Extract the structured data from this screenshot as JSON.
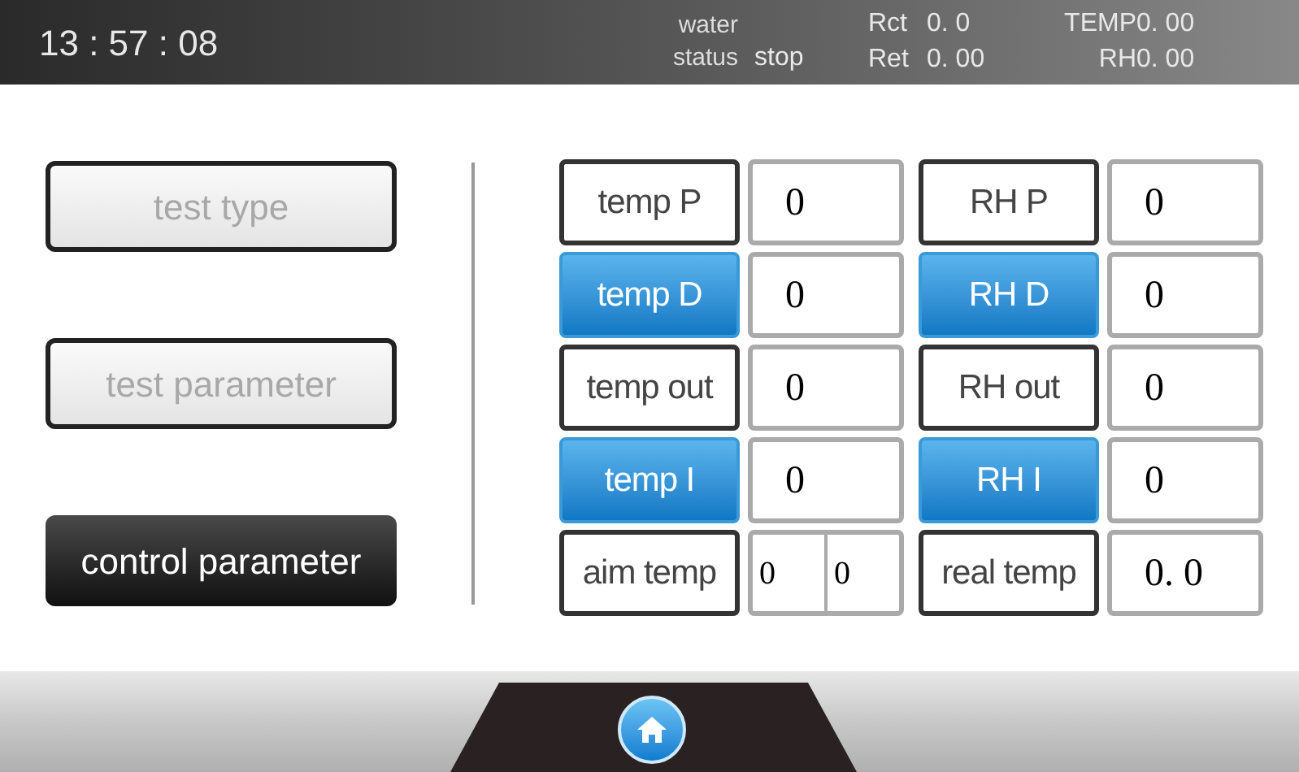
{
  "header": {
    "time": "13 : 57 : 08",
    "water_status": {
      "label_lines": [
        "water",
        "status"
      ],
      "value": "stop"
    },
    "readings": [
      {
        "label": "Rct",
        "value": "0. 0"
      },
      {
        "label": "Ret",
        "value": "0. 00"
      }
    ],
    "readings_right": [
      {
        "label": "TEMP",
        "value": "0. 00"
      },
      {
        "label": "RH",
        "value": "0. 00"
      }
    ]
  },
  "menu": [
    {
      "label": "test type",
      "selected": false
    },
    {
      "label": "test parameter",
      "selected": false
    },
    {
      "label": "control parameter",
      "selected": true
    }
  ],
  "params": [
    {
      "left": {
        "label": "temp P",
        "kind": "plain",
        "values": [
          "0"
        ]
      },
      "right": {
        "label": "RH P",
        "kind": "plain",
        "values": [
          "0"
        ]
      }
    },
    {
      "left": {
        "label": "temp D",
        "kind": "blue",
        "values": [
          "0"
        ]
      },
      "right": {
        "label": "RH D",
        "kind": "blue",
        "values": [
          "0"
        ]
      }
    },
    {
      "left": {
        "label": "temp out",
        "kind": "plain",
        "values": [
          "0"
        ]
      },
      "right": {
        "label": "RH out",
        "kind": "plain",
        "values": [
          "0"
        ]
      }
    },
    {
      "left": {
        "label": "temp I",
        "kind": "blue",
        "values": [
          "0"
        ]
      },
      "right": {
        "label": "RH I",
        "kind": "blue",
        "values": [
          "0"
        ]
      }
    },
    {
      "left": {
        "label": "aim temp",
        "kind": "plain",
        "values": [
          "0",
          "0"
        ]
      },
      "right": {
        "label": "real temp",
        "kind": "plain",
        "values": [
          "0. 0"
        ]
      }
    }
  ]
}
